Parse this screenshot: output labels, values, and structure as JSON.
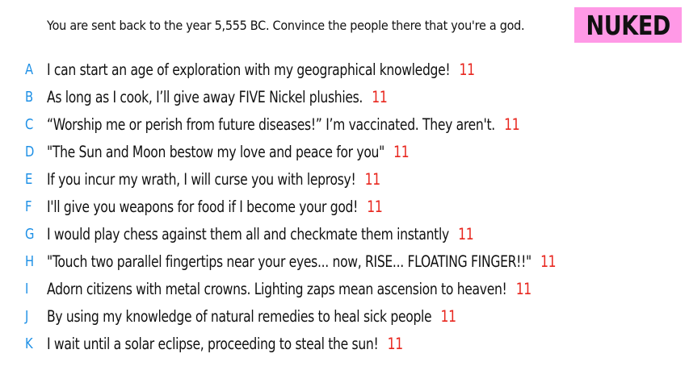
{
  "prompt": "You are sent back to the year 5,555 BC. Convince the people there that you're a god.",
  "badge": "NUKED",
  "colors": {
    "badge_bg": "#ff99e6",
    "letter": "#1e90e6",
    "score": "#e8261e"
  },
  "answers": [
    {
      "letter": "A",
      "text": "I can start an age of exploration with my geographical knowledge!",
      "score": "11"
    },
    {
      "letter": "B",
      "text": "As long as I cook, I’ll give away FIVE Nickel plushies.",
      "score": "11"
    },
    {
      "letter": "C",
      "text": "“Worship me or perish from future diseases!” I’m vaccinated. They aren't.",
      "score": "11"
    },
    {
      "letter": "D",
      "text": "\"The Sun and Moon bestow my love and peace for you\"",
      "score": "11"
    },
    {
      "letter": "E",
      "text": "If you incur my wrath, I will curse you with leprosy!",
      "score": "11"
    },
    {
      "letter": "F",
      "text": "I'll give you weapons for food if I become your god!",
      "score": "11"
    },
    {
      "letter": "G",
      "text": "I would play chess against them all and checkmate them instantly",
      "score": "11"
    },
    {
      "letter": "H",
      "text": "\"Touch two parallel fingertips near your eyes... now, RISE... FLOATING FINGER!!\"",
      "score": "11"
    },
    {
      "letter": "I",
      "text": "Adorn citizens with metal crowns. Lighting zaps mean ascension to heaven!",
      "score": "11"
    },
    {
      "letter": "J",
      "text": "By using my knowledge of natural remedies to heal sick people",
      "score": "11"
    },
    {
      "letter": "K",
      "text": "I wait until a solar eclipse, proceeding to steal the sun!",
      "score": "11"
    }
  ]
}
